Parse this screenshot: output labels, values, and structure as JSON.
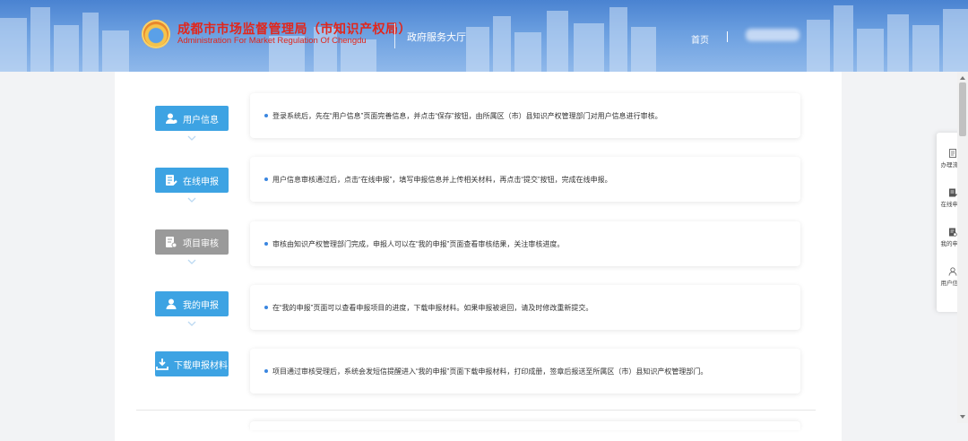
{
  "header": {
    "org_name_cn": "成都市市场监督管理局（市知识产权局）",
    "org_name_en": "Administration For Market Regulation Of Chengdu",
    "hall_label": "政府服务大厅",
    "nav_home": "首页"
  },
  "steps": [
    {
      "label": "用户信息",
      "icon": "user-icon",
      "color": "#3da3e3",
      "desc": "登录系统后，先在“用户信息”页面完善信息，并点击“保存”按钮，由所属区（市）县知识产权管理部门对用户信息进行审核。"
    },
    {
      "label": "在线申报",
      "icon": "document-edit-icon",
      "color": "#3da3e3",
      "desc": "用户信息审核通过后，点击“在线申报”，填写申报信息并上传相关材料，再点击“提交”按钮，完成在线申报。"
    },
    {
      "label": "项目审核",
      "icon": "review-icon",
      "color": "#9a9a9a",
      "desc": "审核由知识产权管理部门完成，申报人可以在“我的申报”页面查看审核结果，关注审核进度。"
    },
    {
      "label": "我的申报",
      "icon": "person-icon",
      "color": "#3da3e3",
      "desc": "在“我的申报”页面可以查看申报项目的进度，下载申报材料。如果申报被退回，请及时修改重新提交。"
    },
    {
      "label": "下载申报材料",
      "icon": "download-icon",
      "color": "#3da3e3",
      "desc": "项目通过审核受理后，系统会发短信提醒进入“我的申报”页面下载申报材料，打印成册，签章后报送至所属区（市）县知识产权管理部门。"
    }
  ],
  "float_menu": [
    {
      "label": "办理流程",
      "icon": "flow-icon"
    },
    {
      "label": "在线申报",
      "icon": "document-edit-icon"
    },
    {
      "label": "我的申报",
      "icon": "review-icon"
    },
    {
      "label": "用户信息",
      "icon": "user-icon"
    }
  ],
  "colors": {
    "accent": "#3da3e3",
    "disabled": "#9a9a9a",
    "header": "#5b92dc",
    "brand_red": "#e2261b"
  }
}
